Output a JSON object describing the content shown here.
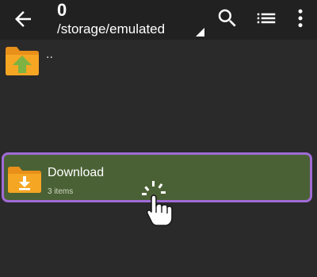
{
  "toolbar": {
    "count": "0",
    "path": "/storage/emulated",
    "icons": [
      "back-arrow-icon",
      "search-icon",
      "list-view-icon",
      "more-vert-icon"
    ]
  },
  "list": {
    "parent_label": "..",
    "items": [
      {
        "name": "Download",
        "meta": "3 items",
        "selected": true
      }
    ]
  },
  "colors": {
    "background": "#2a2a2a",
    "toolbar": "#212121",
    "selected_row": "#4a6135",
    "selected_border": "#a06bd6",
    "folder": "#f5a623",
    "up_arrow": "#7cb342"
  }
}
